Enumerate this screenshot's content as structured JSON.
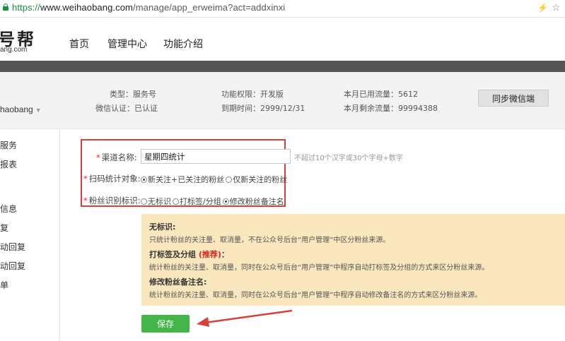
{
  "browser": {
    "url_protocol": "https://",
    "url_host": "www.weihaobang.com",
    "url_path": "/manage/app_erweima?act=addxinxi"
  },
  "header": {
    "logo_text": "号帮",
    "logo_sub": "ang.com",
    "nav": [
      "首页",
      "管理中心",
      "功能介绍"
    ]
  },
  "account": {
    "name": "haobang",
    "type": "类型：服务号",
    "verify": "微信认证：已认证",
    "permission": "功能权限：开发版",
    "expire": "到期时间：2999/12/31",
    "used": "本月已用流量：5612",
    "remain": "本月剩余流量：99994388",
    "sync_label": "同步微信端"
  },
  "sidebar": {
    "items": [
      "服务",
      "报表",
      "信息",
      "复",
      "动回复",
      "动回复",
      "单"
    ]
  },
  "form": {
    "name_label": "渠道名称:",
    "name_value": "星期四统计",
    "name_hint": "不超过10个汉字或30个字母+数字",
    "scan_label": "扫码统计对象:",
    "scan_options": [
      "新关注+已关注的粉丝",
      "仅新关注的粉丝"
    ],
    "fans_label": "粉丝识别标识:",
    "fans_options": [
      "无标识",
      "打标签/分组",
      "修改粉丝备注名"
    ],
    "save_label": "保存"
  },
  "notice": {
    "t1": "无标识:",
    "d1": "只统计粉丝的关注量、取消量，不在公众号后台“用户管理”中区分粉丝来源。",
    "t2": "打标签及分组",
    "t2_rec": "(推荐)",
    "t2_tail": "：",
    "d2": "统计粉丝的关注量、取消量，同时在公众号后台“用户管理”中程序自动打标签及分组的方式来区分粉丝来源。",
    "t3": "修改粉丝备注名:",
    "d3": "统计粉丝的关注量、取消量，同时在公众号后台“用户管理”中程序自动修改备注名的方式来区分粉丝来源。"
  },
  "colors": {
    "accent_green": "#44b549",
    "highlight_red": "#d9403a",
    "notice_bg": "#fae7bd"
  }
}
